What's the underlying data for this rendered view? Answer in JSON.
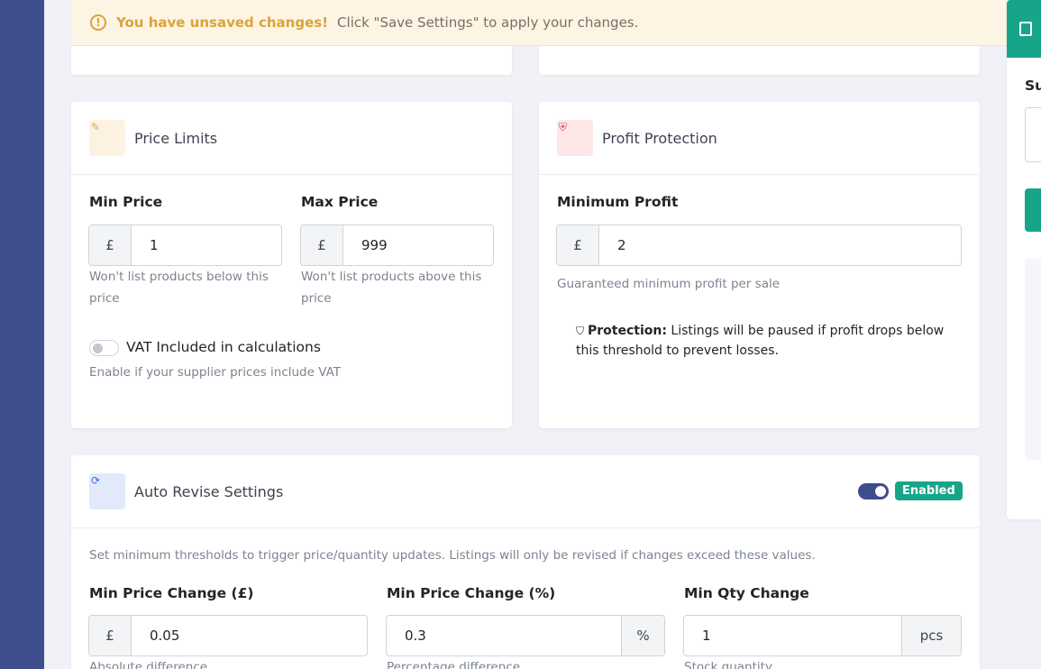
{
  "alert": {
    "strong": "You have unsaved changes!",
    "message": "Click \"Save Settings\" to apply your changes."
  },
  "price_limits": {
    "title": "Price Limits",
    "min_label": "Min Price",
    "min_prefix": "£",
    "min_value": "1",
    "min_help": "Won't list products below this price",
    "max_label": "Max Price",
    "max_prefix": "£",
    "max_value": "999",
    "max_help": "Won't list products above this price",
    "vat_label": "VAT Included in calculations",
    "vat_help": "Enable if your supplier prices include VAT"
  },
  "profit_protection": {
    "title": "Profit Protection",
    "min_profit_label": "Minimum Profit",
    "prefix": "£",
    "value": "2",
    "help": "Guaranteed minimum profit per sale",
    "note_strong": "Protection:",
    "note_text": "Listings will be paused if profit drops below this threshold to prevent losses."
  },
  "auto_revise": {
    "title": "Auto Revise Settings",
    "status_badge": "Enabled",
    "description": "Set minimum thresholds to trigger price/quantity updates. Listings will only be revised if changes exceed these values.",
    "fields": [
      {
        "label": "Min Price Change (£)",
        "prefix": "£",
        "value": "0.05",
        "help": "Absolute difference"
      },
      {
        "label": "Min Price Change (%)",
        "suffix": "%",
        "value": "0.3",
        "help": "Percentage difference"
      },
      {
        "label": "Min Qty Change",
        "suffix": "pcs",
        "value": "1",
        "help": "Stock quantity"
      }
    ]
  },
  "right_panel": {
    "label_partial": "Su"
  },
  "colors": {
    "sidebar": "#3e4d8b",
    "accent_teal": "#17a589",
    "warning": "#d9a43a",
    "background": "#f1f1f8"
  },
  "icons": [
    "alert-circle-icon",
    "ruler-icon",
    "shield-icon",
    "refresh-icon",
    "shield-check-icon",
    "calculator-icon"
  ]
}
